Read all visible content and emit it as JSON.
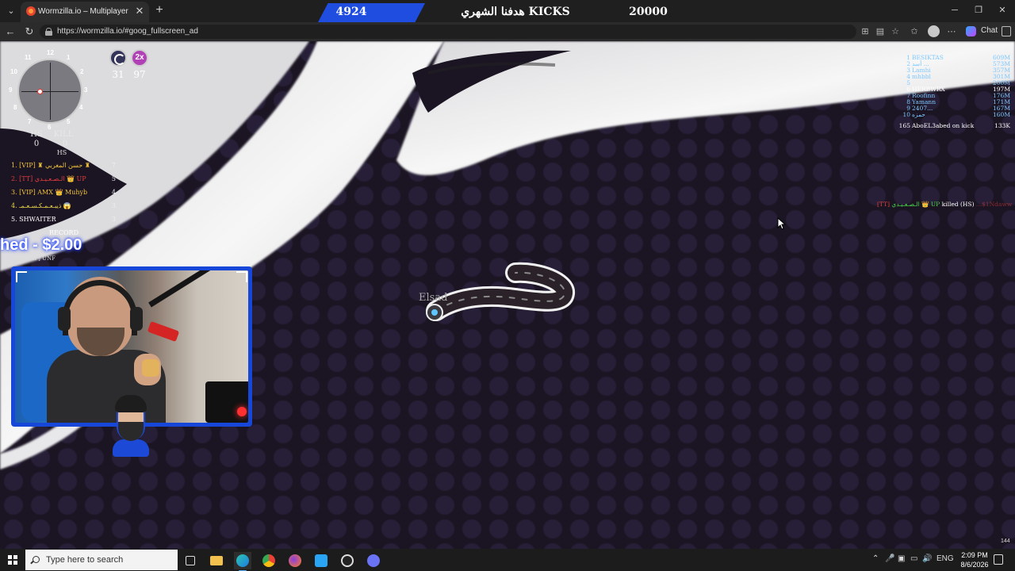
{
  "browser": {
    "tab_title": "Wormzilla.io – Multiplayer Snake G",
    "url": "https://wormzilla.io/#goog_fullscreen_ad",
    "chat_label": "Chat"
  },
  "stream_banner": {
    "left_value": "4924",
    "title": "هدفنا الشهري KICKS",
    "right_value": "20000"
  },
  "game": {
    "minimap": {
      "clock_numbers": [
        "12",
        "1",
        "2",
        "3",
        "4",
        "5",
        "6",
        "7",
        "8",
        "9",
        "10",
        "11"
      ],
      "zoom": "1x"
    },
    "hs_label": "HS",
    "hs_value": "0",
    "kill_label": "KILL",
    "kill_value": "0",
    "hs_sub_label": "HS",
    "buffs": [
      {
        "icon": "ring-buff-icon",
        "count": "31"
      },
      {
        "icon": "double-score-icon",
        "label": "2x",
        "count": "97"
      }
    ],
    "kill_leaderboard": [
      {
        "name": "1. [VIP] ♜ حسن المغربي ♜",
        "value": "7",
        "color": "#f0c23a"
      },
      {
        "name": "2. [TT] الـصـعـيـدي 👑 UP",
        "value": "5",
        "color": "#e13d3d"
      },
      {
        "name": "3. [VIP] AMX 👑 Muhyb",
        "value": "4",
        "color": "#f0c23a"
      },
      {
        "name": "4. ذيبـعـمـكـسـعـمـ 😱",
        "value": "3",
        "color": "#e8d24a"
      },
      {
        "name": "5. SHWAITER",
        "value": "3",
        "color": "#ffffff"
      }
    ],
    "record_label": "RECORD",
    "donation_text": "hed - $2.00",
    "donation_sub": "2. [VIP] UNF",
    "player_name": "Elsad",
    "leaderboard": [
      {
        "rank": "1",
        "name": "BESIKTAS",
        "score": "609M",
        "color": "#7ec8ff"
      },
      {
        "rank": "2",
        "name": "أسد ...",
        "score": "573M",
        "color": "#7ec8ff"
      },
      {
        "rank": "3",
        "name": "Lamhi",
        "score": "357M",
        "color": "#7ec8ff"
      },
      {
        "rank": "4",
        "name": "mhbbl",
        "score": "301M",
        "color": "#7ec8ff"
      },
      {
        "rank": "5",
        "name": "",
        "score": "200M",
        "color": "#7ec8ff"
      },
      {
        "rank": "6",
        "name": "HERBWRX",
        "score": "197M",
        "color": "#ffffff"
      },
      {
        "rank": "7",
        "name": "Roofinn",
        "score": "176M",
        "color": "#7ec8ff"
      },
      {
        "rank": "8",
        "name": "Yamann",
        "score": "171M",
        "color": "#7ec8ff"
      },
      {
        "rank": "9",
        "name": "2407...",
        "score": "167M",
        "color": "#7ec8ff"
      },
      {
        "rank": "10",
        "name": "حمزه",
        "score": "160M",
        "color": "#7ec8ff"
      }
    ],
    "my_rank": {
      "rank": "165",
      "name": "AboEL3abed on kick",
      "score": "133K"
    },
    "killfeed": {
      "tag": "[TT]",
      "killer": "الـصـعـيـدي 👑 UP",
      "action": "killed (HS)",
      "victim": "...$1Ndaww"
    },
    "fps": "144"
  },
  "taskbar": {
    "search_placeholder": "Type here to search",
    "language": "ENG",
    "time": "2:09 PM",
    "date": "8/6/2026"
  },
  "colors": {
    "accent_blue": "#1747d9",
    "game_bg": "#1b1422",
    "banner_blue": "#1f4de0"
  }
}
